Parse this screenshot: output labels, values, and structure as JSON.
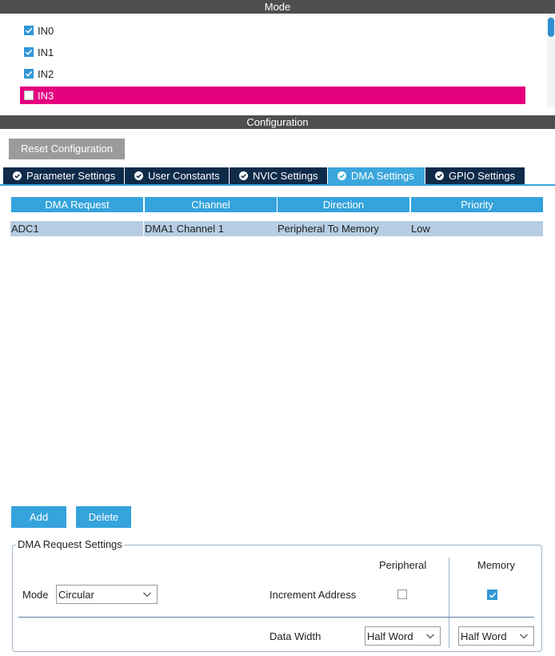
{
  "mode": {
    "header": "Mode",
    "items": [
      {
        "label": "IN0",
        "checked": true
      },
      {
        "label": "IN1",
        "checked": true
      },
      {
        "label": "IN2",
        "checked": true
      },
      {
        "label": "IN3",
        "checked": false,
        "selected": true
      }
    ]
  },
  "configuration": {
    "header": "Configuration",
    "reset_label": "Reset Configuration",
    "tabs": [
      {
        "label": "Parameter Settings",
        "active": false
      },
      {
        "label": "User Constants",
        "active": false
      },
      {
        "label": "NVIC Settings",
        "active": false
      },
      {
        "label": "DMA Settings",
        "active": true
      },
      {
        "label": "GPIO Settings",
        "active": false
      }
    ]
  },
  "dma_table": {
    "columns": [
      "DMA Request",
      "Channel",
      "Direction",
      "Priority"
    ],
    "rows": [
      [
        "ADC1",
        "DMA1 Channel 1",
        "Peripheral To Memory",
        "Low"
      ]
    ]
  },
  "actions": {
    "add_label": "Add",
    "delete_label": "Delete"
  },
  "request_settings": {
    "legend": "DMA Request Settings",
    "peripheral_header": "Peripheral",
    "memory_header": "Memory",
    "mode_label": "Mode",
    "mode_value": "Circular",
    "increment_label": "Increment Address",
    "increment_peripheral": false,
    "increment_memory": true,
    "data_width_label": "Data Width",
    "data_width_peripheral": "Half Word",
    "data_width_memory": "Half Word"
  },
  "colors": {
    "header_bg": "#4e4e4e",
    "accent_blue": "#35a3dc",
    "selected_row": "#e4007f",
    "tab_dark": "#0f2b4a",
    "row_highlight": "#b6cde3"
  }
}
